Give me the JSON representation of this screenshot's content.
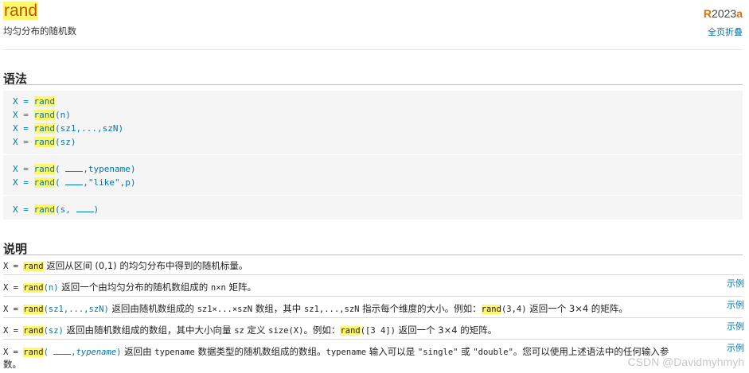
{
  "header": {
    "title": "rand",
    "subtitle": "均匀分布的随机数",
    "release_letter": "R",
    "release_year": "2023",
    "release_suffix": "a",
    "collapse_all": "全页折叠"
  },
  "syntax": {
    "heading": "语法",
    "lines": {
      "l1_pre": "X = ",
      "l1_fn": "rand",
      "l1_post": "",
      "l2_pre": "X = ",
      "l2_fn": "rand",
      "l2_post": "(n)",
      "l3_pre": "X = ",
      "l3_fn": "rand",
      "l3_post": "(sz1,...,szN)",
      "l4_pre": "X = ",
      "l4_fn": "rand",
      "l4_post": "(sz)",
      "l5_pre": "X = ",
      "l5_fn": "rand",
      "l5_a": "( ",
      "l5_b": ",typename)",
      "l6_pre": "X = ",
      "l6_fn": "rand",
      "l6_a": "( ",
      "l6_b": ",\"like\",p)",
      "l7_pre": "X = ",
      "l7_fn": "rand",
      "l7_a": "(s, ",
      "l7_b": ")"
    }
  },
  "description": {
    "heading": "说明",
    "example_label": "示例",
    "row1": {
      "a": "X = ",
      "fn": "rand",
      "b": " 返回从区间 (0,1) 的均匀分布中得到的随机标量。"
    },
    "row2": {
      "a": "X = ",
      "fn": "rand",
      "args": "(n)",
      "b": " 返回一个由均匀分布的随机数组成的 ",
      "c": "n×n",
      "d": " 矩阵。"
    },
    "row3": {
      "a": "X = ",
      "fn": "rand",
      "args": "(sz1,...,szN)",
      "b": " 返回由随机数组成的 ",
      "c": "sz1×...×szN",
      "d": " 数组，其中 ",
      "e": "sz1,...,szN",
      "f": " 指示每个维度的大小。例如：",
      "fn2": "rand",
      "g": "(3,4)",
      "h": " 返回一个 3×4 的矩阵。"
    },
    "row4": {
      "a": "X = ",
      "fn": "rand",
      "args": "(sz)",
      "b": " 返回由随机数组成的数组，其中大小向量 ",
      "c": "sz",
      "d": " 定义 ",
      "e": "size(X)",
      "f": "。例如：",
      "fn2": "rand",
      "g": "([3 4])",
      "h": " 返回一个 3×4 的矩阵。"
    },
    "row5": {
      "a": "X = ",
      "fn": "rand",
      "args_a": "( ",
      "args_b": ",",
      "typename": "typename",
      "args_c": ")",
      "b": " 返回由 ",
      "c": "typename",
      "d": " 数据类型的随机数组成的数组。",
      "e": "typename",
      "f": " 输入可以是 ",
      "g": "\"single\"",
      "h": " 或 ",
      "i": "\"double\"",
      "j": "。您可以使用上述语法中的任何输入参",
      "k": "数。"
    }
  },
  "watermark": "CSDN @Davidmyhmyh"
}
